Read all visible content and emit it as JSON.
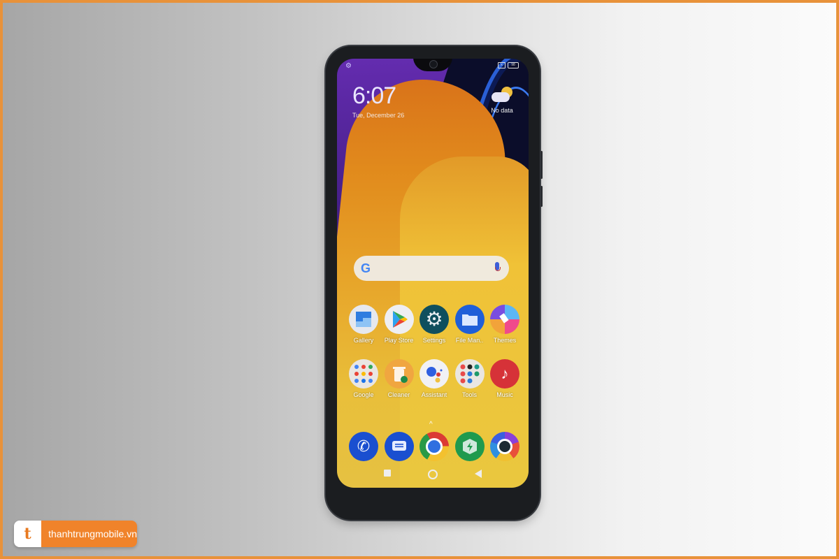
{
  "status_bar": {
    "sim_label": "x",
    "battery_level": "98"
  },
  "lockscreen": {
    "time": "6:07",
    "date": "Tue, December 26"
  },
  "weather": {
    "label": "No data"
  },
  "search_bar": {
    "logo": "G"
  },
  "apps_row1": [
    {
      "label": "Gallery",
      "icon": "gallery-icon"
    },
    {
      "label": "Play Store",
      "icon": "play-store-icon"
    },
    {
      "label": "Settings",
      "icon": "settings-icon"
    },
    {
      "label": "File Man..",
      "icon": "file-manager-icon"
    },
    {
      "label": "Themes",
      "icon": "themes-icon"
    }
  ],
  "apps_row2": [
    {
      "label": "Google",
      "icon": "google-folder-icon"
    },
    {
      "label": "Cleaner",
      "icon": "cleaner-icon"
    },
    {
      "label": "Assistant",
      "icon": "assistant-icon"
    },
    {
      "label": "Tools",
      "icon": "tools-folder-icon"
    },
    {
      "label": "Music",
      "icon": "music-icon"
    }
  ],
  "dock": [
    {
      "name": "Phone",
      "icon": "phone-icon"
    },
    {
      "name": "Messages",
      "icon": "messages-icon"
    },
    {
      "name": "Chrome",
      "icon": "chrome-icon"
    },
    {
      "name": "Security",
      "icon": "security-icon"
    },
    {
      "name": "Browser",
      "icon": "browser-icon"
    }
  ],
  "drawer_hint": "^",
  "watermark": {
    "logo_letter": "t",
    "text": "thanhtrungmobile.vn"
  },
  "colors": {
    "frame_border": "#e8923a",
    "brand_orange": "#f0832a"
  }
}
